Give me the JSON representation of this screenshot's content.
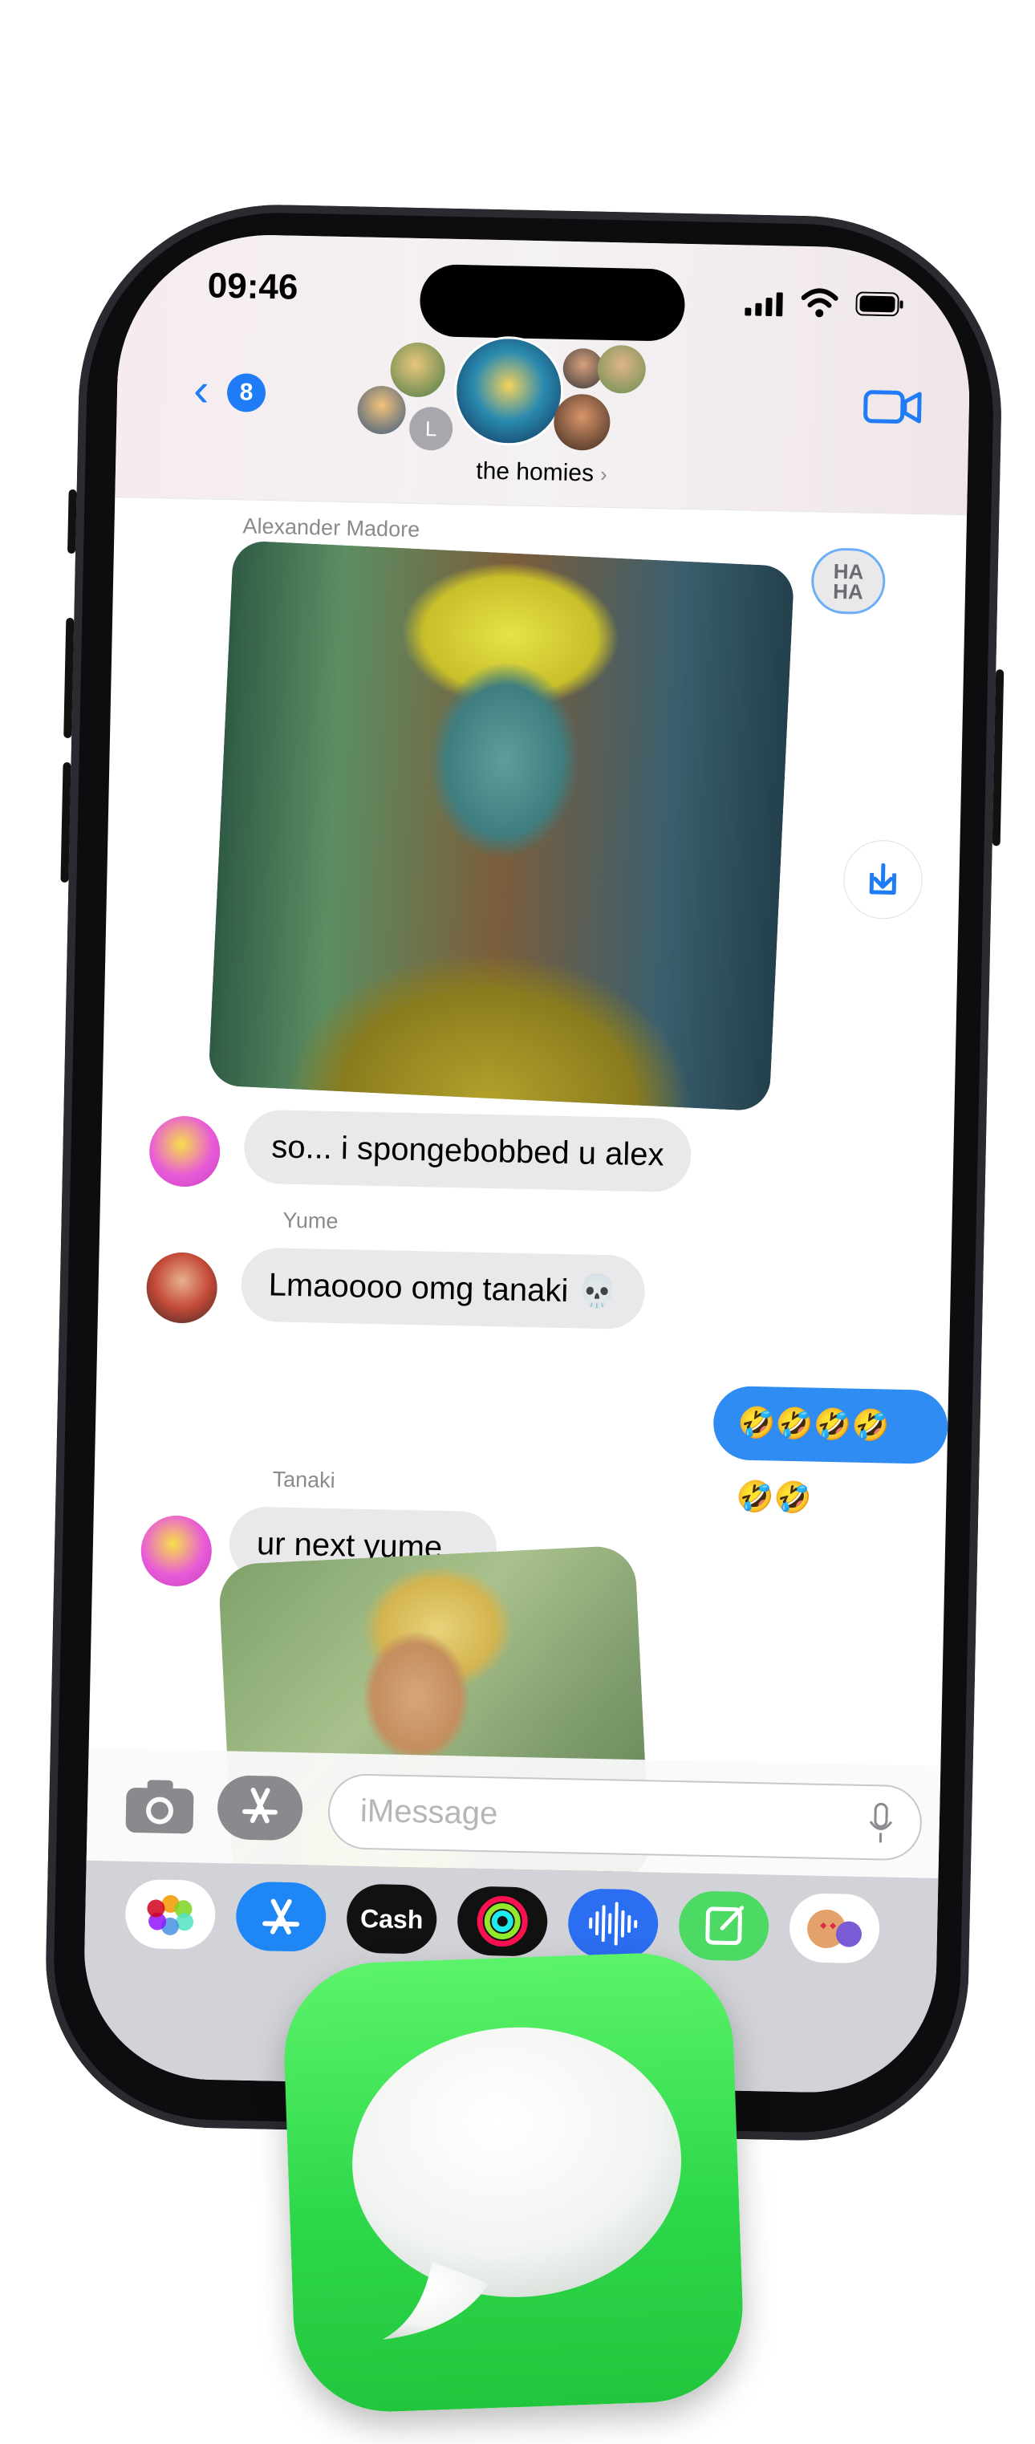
{
  "status": {
    "time": "09:46"
  },
  "header": {
    "back_badge": "8",
    "group_name": "the homies",
    "group_chevron": "›",
    "avatar_initial": "L"
  },
  "messages": [
    {
      "sender": "Alexander Madore",
      "reaction": "HA HA",
      "reaction_line1": "HA",
      "reaction_line2": "HA"
    },
    {
      "text": "so... i spongebobbed u alex"
    },
    {
      "sender": "Yume",
      "text": "Lmaoooo omg tanaki 💀"
    },
    {
      "text": "🤣🤣🤣🤣🤣🤣"
    },
    {
      "sender": "Tanaki",
      "text": "ur next yume..."
    }
  ],
  "composer": {
    "placeholder": "iMessage"
  },
  "tray": {
    "apps": [
      "photos-icon",
      "app-store-icon",
      "apple-cash-icon",
      "activity-icon",
      "voice-memo-icon",
      "notes-icon",
      "memoji-icon"
    ],
    "cash_label": "Cash"
  },
  "colors": {
    "blue": "#1f7cf6",
    "outgoing": "#2f8cf2",
    "incoming": "#e9e9eb",
    "messages_green": "#2fd84b"
  }
}
